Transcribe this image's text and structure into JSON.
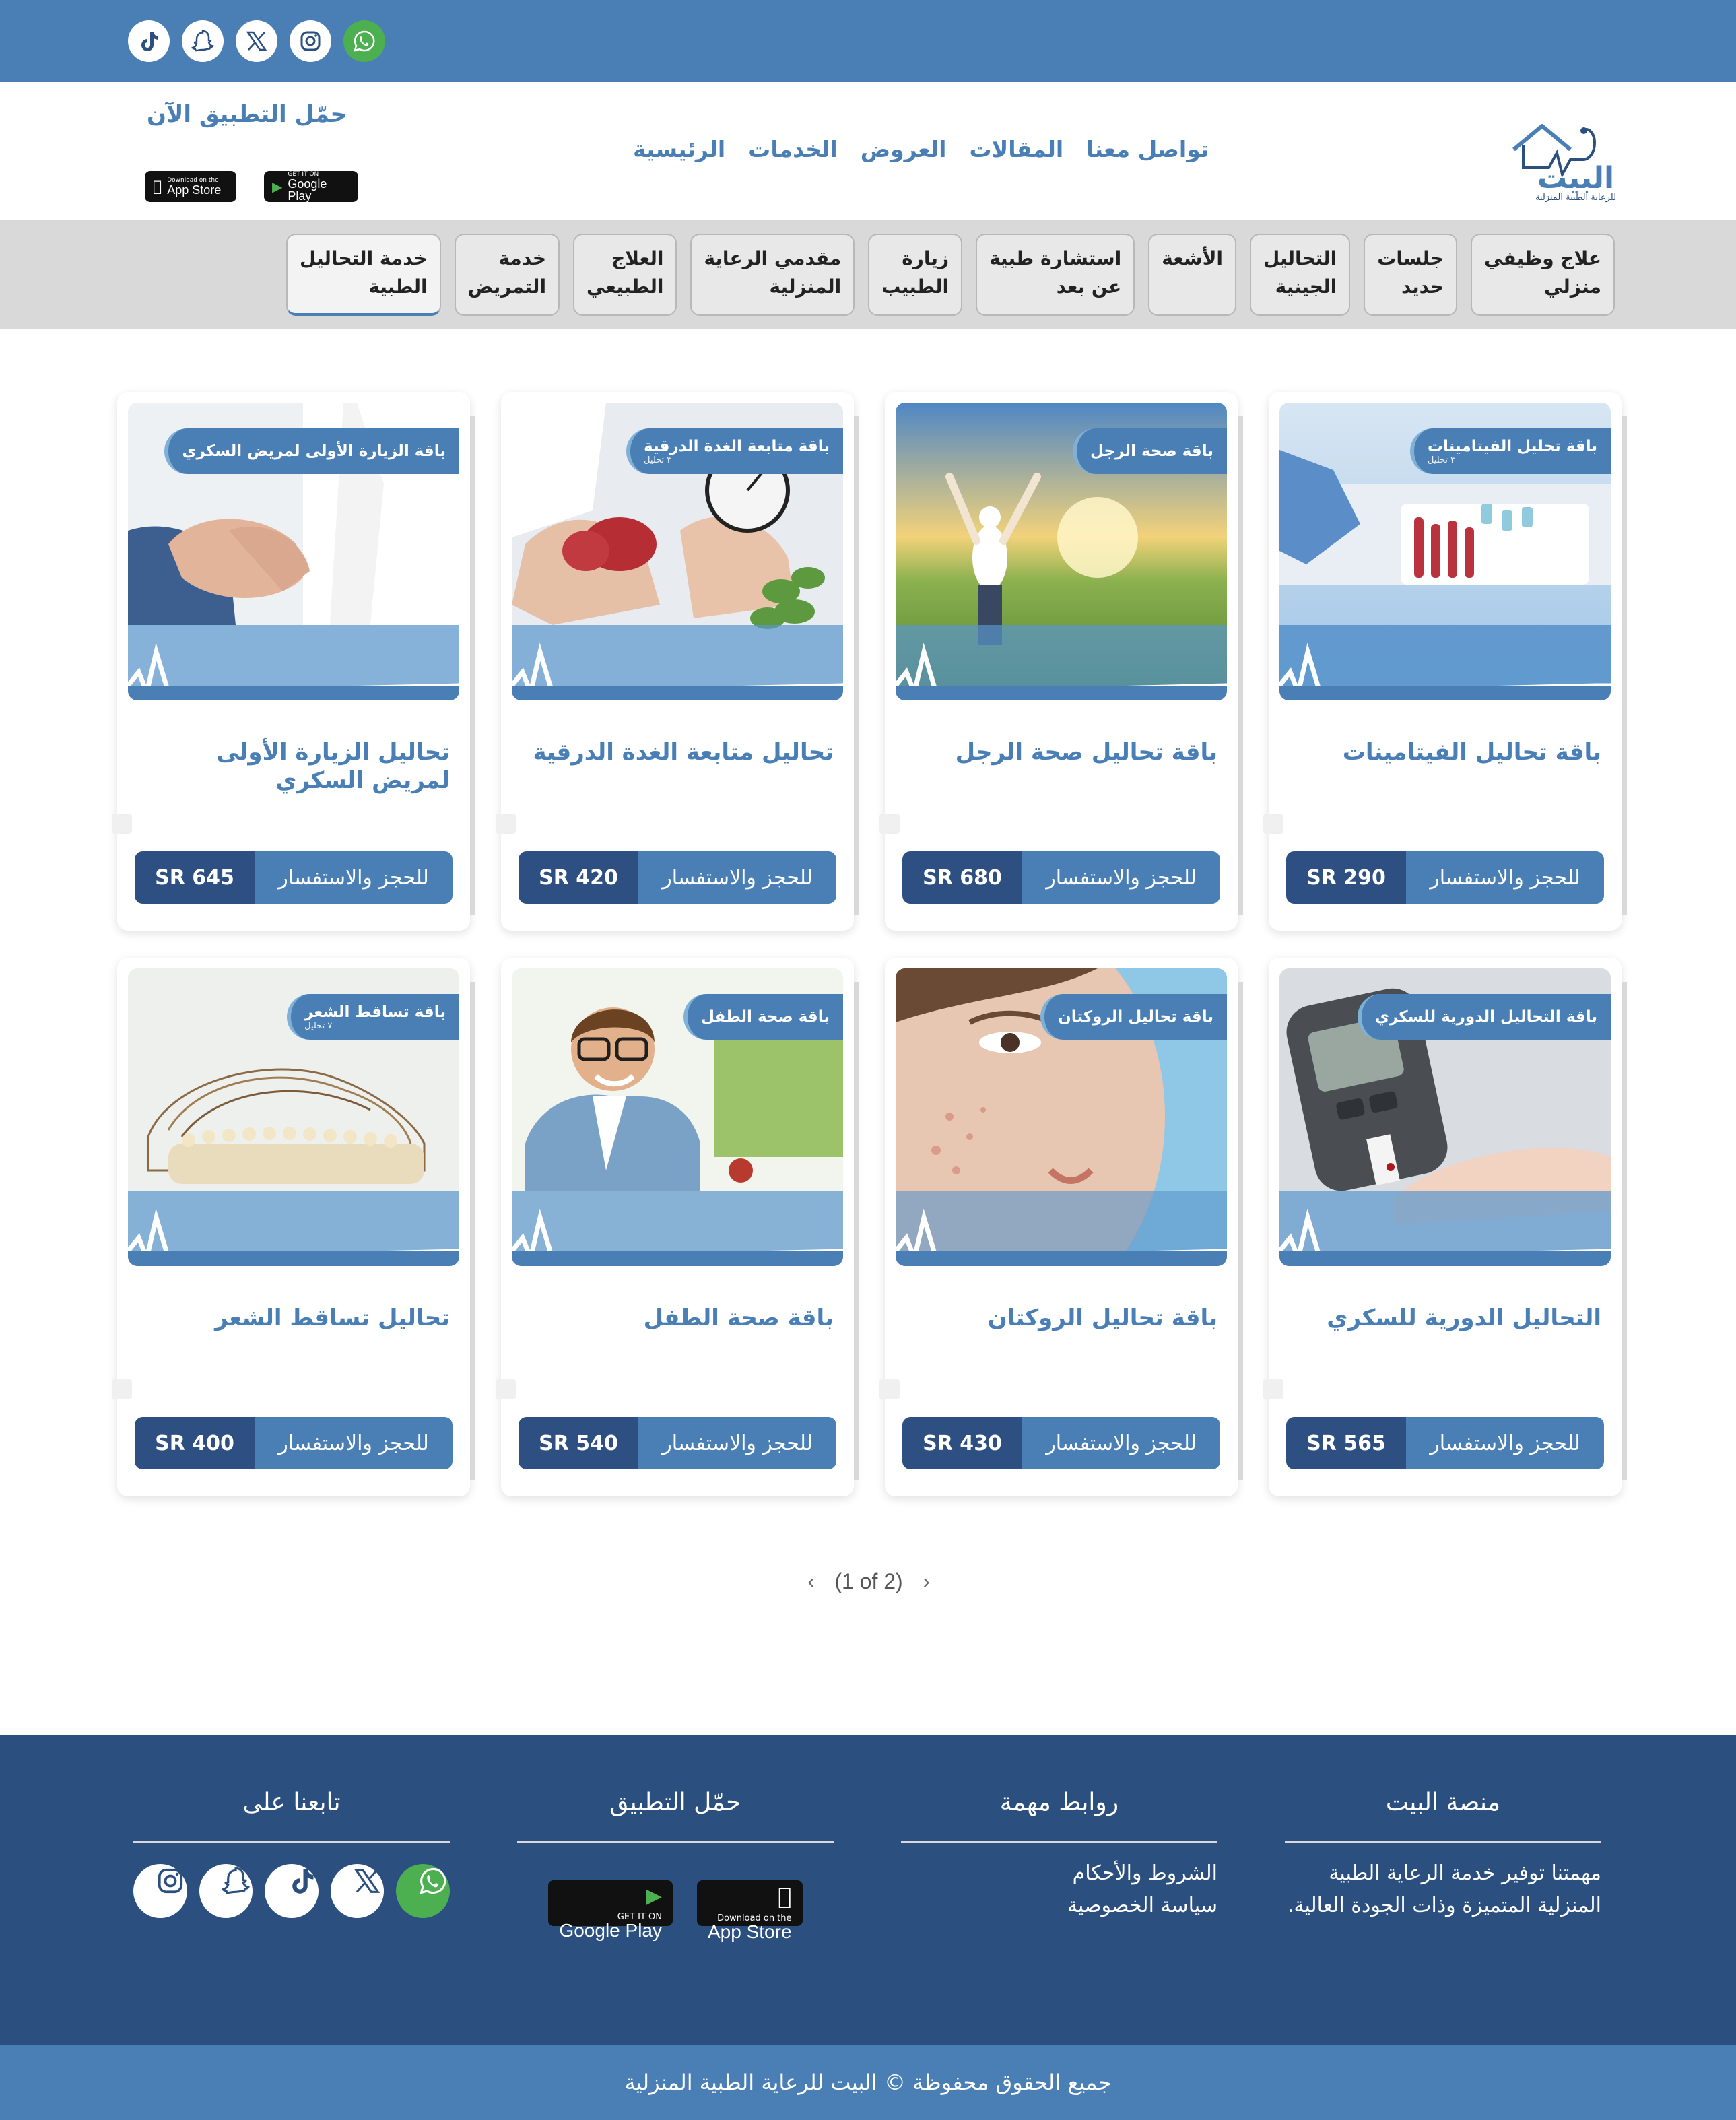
{
  "socials": [
    "tiktok-icon",
    "snapchat-icon",
    "x-icon",
    "instagram-icon",
    "whatsapp-icon"
  ],
  "logo": {
    "name": "البيت",
    "tagline": "للرعاية الطبية المنزلية"
  },
  "nav": [
    "الرئيسية",
    "الخدمات",
    "العروض",
    "المقالات",
    "تواصل معنا"
  ],
  "app": {
    "title": "حمّل التطبيق الآن",
    "appstore_small": "Download on the",
    "appstore_big": "App Store",
    "googleplay_small": "GET IT ON",
    "googleplay_big": "Google Play"
  },
  "categories": [
    {
      "line1": "خدمة التحاليل",
      "line2": "الطبية"
    },
    {
      "line1": "خدمة",
      "line2": "التمريض"
    },
    {
      "line1": "العلاج",
      "line2": "الطبيعي"
    },
    {
      "line1": "مقدمي الرعاية",
      "line2": "المنزلية"
    },
    {
      "line1": "زيارة",
      "line2": "الطبيب"
    },
    {
      "line1": "استشارة طبية",
      "line2": "عن بعد"
    },
    {
      "line1": "الأشعة",
      "line2": ""
    },
    {
      "line1": "التحاليل",
      "line2": "الجينية"
    },
    {
      "line1": "جلسات",
      "line2": "حديد"
    },
    {
      "line1": "علاج وظيفي",
      "line2": "منزلي"
    }
  ],
  "cards": [
    {
      "badge": "باقة تحليل الفيتامينات",
      "badge_sub": "٣ تحليل",
      "title": "باقة تحاليل الفيتامينات",
      "price": "SR 290",
      "cta": "للحجز والاستفسار"
    },
    {
      "badge": "باقة صحة الرجل",
      "badge_sub": "",
      "title": "باقة تحاليل صحة الرجل",
      "price": "SR 680",
      "cta": "للحجز والاستفسار"
    },
    {
      "badge": "باقة متابعة الغدة الدرقية",
      "badge_sub": "٣ تحليل",
      "title": "تحاليل متابعة الغدة الدرقية",
      "price": "SR 420",
      "cta": "للحجز والاستفسار"
    },
    {
      "badge": "باقة الزيارة الأولى لمريض السكري",
      "badge_sub": "",
      "title": "تحاليل الزيارة الأولى لمريض السكري",
      "price": "SR 645",
      "cta": "للحجز والاستفسار"
    },
    {
      "badge": "باقة التحاليل الدورية للسكري",
      "badge_sub": "",
      "title": "التحاليل الدورية للسكري",
      "price": "SR 565",
      "cta": "للحجز والاستفسار"
    },
    {
      "badge": "باقة تحاليل الروكتان",
      "badge_sub": "",
      "title": "باقة تحاليل الروكتان",
      "price": "SR 430",
      "cta": "للحجز والاستفسار"
    },
    {
      "badge": "باقة صحة الطفل",
      "badge_sub": "",
      "title": "باقة صحة الطفل",
      "price": "SR 540",
      "cta": "للحجز والاستفسار"
    },
    {
      "badge": "باقة تساقط الشعر",
      "badge_sub": "٧ تحليل",
      "title": "تحاليل تساقط الشعر",
      "price": "SR 400",
      "cta": "للحجز والاستفسار"
    }
  ],
  "pager": {
    "text": "(1 of 2)",
    "prev": "‹",
    "next": "›"
  },
  "footer": {
    "platform_title": "منصة البيت",
    "platform_text": "مهمتنا توفير خدمة الرعاية الطبية المنزلية المتميزة وذات الجودة العالية.",
    "links_title": "روابط مهمة",
    "links": [
      "الشروط والأحكام",
      "سياسة الخصوصية"
    ],
    "download_title": "حمّل التطبيق",
    "follow_title": "تابعنا على"
  },
  "copyright": "جميع الحقوق محفوظة © البيت للرعاية الطبية المنزلية",
  "colors": {
    "primary": "#4a7fb6",
    "dark": "#2b4f7e",
    "price": "#2e4f82",
    "whatsapp": "#4caf50"
  }
}
